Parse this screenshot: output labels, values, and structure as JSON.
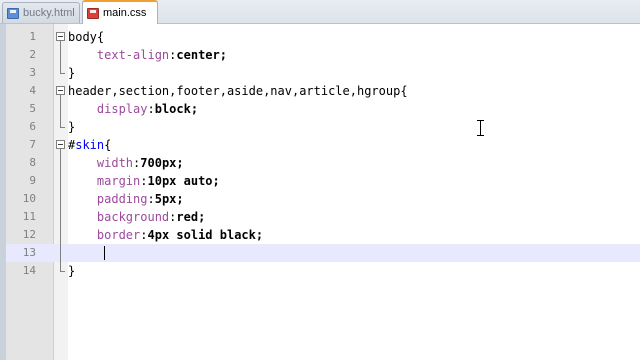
{
  "tabs": [
    {
      "label": "bucky.html",
      "active": false,
      "icon": "saved-file-icon"
    },
    {
      "label": "main.css",
      "active": true,
      "icon": "unsaved-file-icon"
    }
  ],
  "editor": {
    "current_line": 13,
    "lines": [
      {
        "num": "1",
        "selector": "body",
        "brace": "{",
        "property": "",
        "value": ""
      },
      {
        "num": "2",
        "selector": "",
        "brace": "",
        "property": "text-align",
        "value": "center;"
      },
      {
        "num": "3",
        "selector": "",
        "brace": "}",
        "property": "",
        "value": ""
      },
      {
        "num": "4",
        "selector": "header,section,footer,aside,nav,article,hgroup",
        "brace": "{",
        "property": "",
        "value": ""
      },
      {
        "num": "5",
        "selector": "",
        "brace": "",
        "property": "display",
        "value": "block;"
      },
      {
        "num": "6",
        "selector": "",
        "brace": "}",
        "property": "",
        "value": ""
      },
      {
        "num": "7",
        "selector": "#",
        "id": "skin",
        "brace": "{",
        "property": "",
        "value": ""
      },
      {
        "num": "8",
        "selector": "",
        "brace": "",
        "property": "width",
        "value": "700px;"
      },
      {
        "num": "9",
        "selector": "",
        "brace": "",
        "property": "margin",
        "value": "10px auto;"
      },
      {
        "num": "10",
        "selector": "",
        "brace": "",
        "property": "padding",
        "value": "5px;"
      },
      {
        "num": "11",
        "selector": "",
        "brace": "",
        "property": "background",
        "value": "red;"
      },
      {
        "num": "12",
        "selector": "",
        "brace": "",
        "property": "border",
        "value": "4px solid black;"
      },
      {
        "num": "13",
        "selector": "",
        "brace": "",
        "property": "",
        "value": ""
      },
      {
        "num": "14",
        "selector": "",
        "brace": "}",
        "property": "",
        "value": ""
      }
    ]
  },
  "colors": {
    "current_line_bg": "#e8e8ff",
    "gutter_bg": "#e4e4e4",
    "id_color": "#0000ff",
    "property_color": "#9b4a9b",
    "active_tab_accent": "#f0a030"
  }
}
